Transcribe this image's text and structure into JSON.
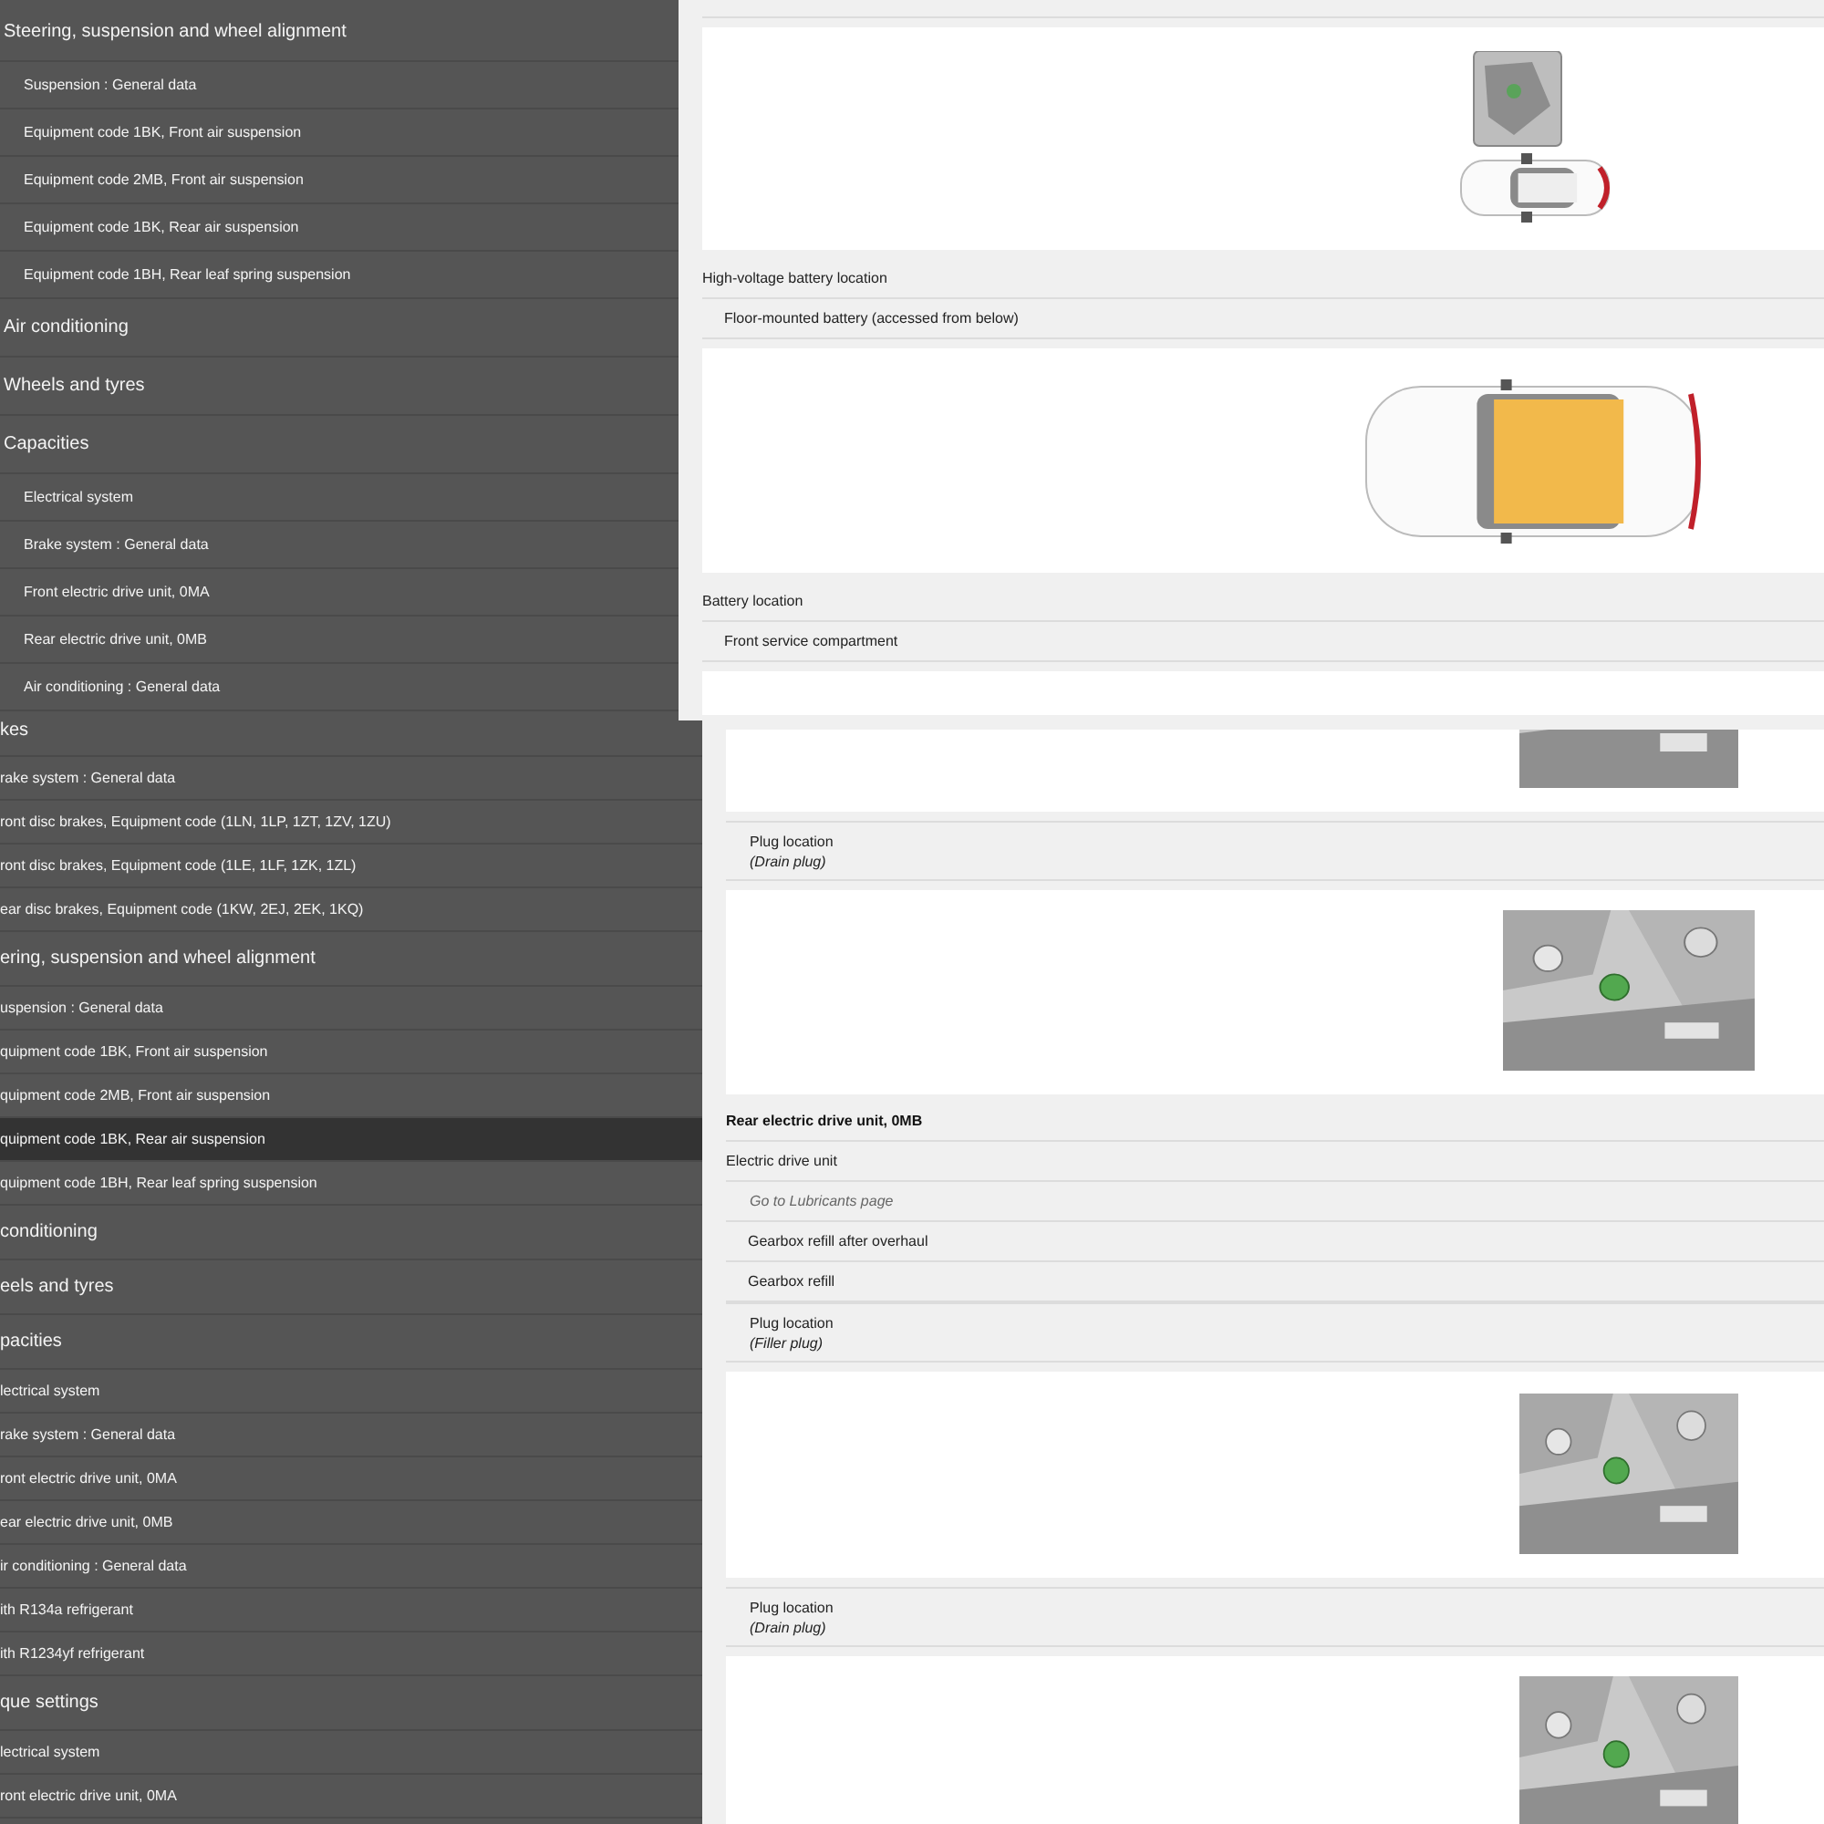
{
  "screens": [
    {
      "sidebar": [
        {
          "kind": "section",
          "label": "Steering, suspension and wheel alignment",
          "selected": false
        },
        {
          "kind": "item",
          "label": "Suspension : General data",
          "selected": false
        },
        {
          "kind": "item",
          "label": "Equipment code 1BK, Front air suspension",
          "selected": false
        },
        {
          "kind": "item",
          "label": "Equipment code 2MB, Front air suspension",
          "selected": false
        },
        {
          "kind": "item",
          "label": "Equipment code 1BK, Rear air suspension",
          "selected": false
        },
        {
          "kind": "item",
          "label": "Equipment code 1BH, Rear leaf spring suspension",
          "selected": false
        },
        {
          "kind": "section",
          "label": "Air conditioning",
          "selected": false
        },
        {
          "kind": "section",
          "label": "Wheels and tyres",
          "selected": false
        },
        {
          "kind": "section",
          "label": "Capacities",
          "selected": false
        },
        {
          "kind": "item",
          "label": "Electrical system",
          "selected": false
        },
        {
          "kind": "item",
          "label": "Brake system : General data",
          "selected": false
        },
        {
          "kind": "item",
          "label": "Front electric drive unit, 0MA",
          "selected": false
        },
        {
          "kind": "item",
          "label": "Rear electric drive unit, 0MB",
          "selected": false
        },
        {
          "kind": "item",
          "label": "Air conditioning : General data",
          "selected": false
        }
      ],
      "content": [
        {
          "kind": "picture"
        },
        {
          "kind": "heading",
          "label": "High-voltage battery location"
        },
        {
          "kind": "row",
          "label": "Floor-mounted battery (accessed from below)"
        },
        {
          "kind": "picture"
        },
        {
          "kind": "heading",
          "label": "Battery location"
        },
        {
          "kind": "row",
          "label": "Front service compartment"
        },
        {
          "kind": "panel"
        }
      ]
    },
    {
      "sidebar": [
        {
          "kind": "section",
          "label": "kes",
          "selected": false
        },
        {
          "kind": "item",
          "label": "rake system : General data",
          "selected": false
        },
        {
          "kind": "item",
          "label": "ront disc brakes, Equipment code (1LN, 1LP, 1ZT, 1ZV, 1ZU)",
          "selected": false
        },
        {
          "kind": "item",
          "label": "ront disc brakes, Equipment code (1LE, 1LF, 1ZK, 1ZL)",
          "selected": false
        },
        {
          "kind": "item",
          "label": "ear disc brakes, Equipment code (1KW, 2EJ, 2EK, 1KQ)",
          "selected": false
        },
        {
          "kind": "section",
          "label": "ering, suspension and wheel alignment",
          "selected": false
        },
        {
          "kind": "item",
          "label": "uspension : General data",
          "selected": false
        },
        {
          "kind": "item",
          "label": "quipment code 1BK, Front air suspension",
          "selected": false
        },
        {
          "kind": "item",
          "label": "quipment code 2MB, Front air suspension",
          "selected": false
        },
        {
          "kind": "item",
          "label": "quipment code 1BK, Rear air suspension",
          "selected": true
        },
        {
          "kind": "item",
          "label": "quipment code 1BH, Rear leaf spring suspension",
          "selected": false
        },
        {
          "kind": "section",
          "label": "conditioning",
          "selected": false
        },
        {
          "kind": "section",
          "label": "eels and tyres",
          "selected": false
        },
        {
          "kind": "section",
          "label": "pacities",
          "selected": false
        },
        {
          "kind": "item",
          "label": "lectrical system",
          "selected": false
        },
        {
          "kind": "item",
          "label": "rake system : General data",
          "selected": false
        },
        {
          "kind": "item",
          "label": "ront electric drive unit, 0MA",
          "selected": false
        },
        {
          "kind": "item",
          "label": "ear electric drive unit, 0MB",
          "selected": false
        },
        {
          "kind": "item",
          "label": "ir conditioning : General data",
          "selected": false
        },
        {
          "kind": "item",
          "label": "ith R134a refrigerant",
          "selected": false
        },
        {
          "kind": "item",
          "label": "ith R1234yf refrigerant",
          "selected": false
        },
        {
          "kind": "section",
          "label": "que settings",
          "selected": false
        },
        {
          "kind": "item",
          "label": "lectrical system",
          "selected": false
        },
        {
          "kind": "item",
          "label": "ront electric drive unit, 0MA",
          "selected": false
        }
      ],
      "content": [
        {
          "kind": "picture"
        },
        {
          "kind": "plug",
          "label": "Plug location",
          "note": "(Drain plug)"
        },
        {
          "kind": "picture"
        },
        {
          "kind": "title",
          "label": "Rear electric drive unit, 0MB"
        },
        {
          "kind": "heading",
          "label": "Electric drive unit"
        },
        {
          "kind": "link",
          "label": "Go to Lubricants page"
        },
        {
          "kind": "row",
          "label": "Gearbox refill after overhaul"
        },
        {
          "kind": "row",
          "label": "Gearbox refill"
        },
        {
          "kind": "plug",
          "label": "Plug location",
          "note": "(Filler plug)"
        },
        {
          "kind": "picture"
        },
        {
          "kind": "plug",
          "label": "Plug location",
          "note": "(Drain plug)"
        },
        {
          "kind": "picture"
        }
      ]
    }
  ]
}
